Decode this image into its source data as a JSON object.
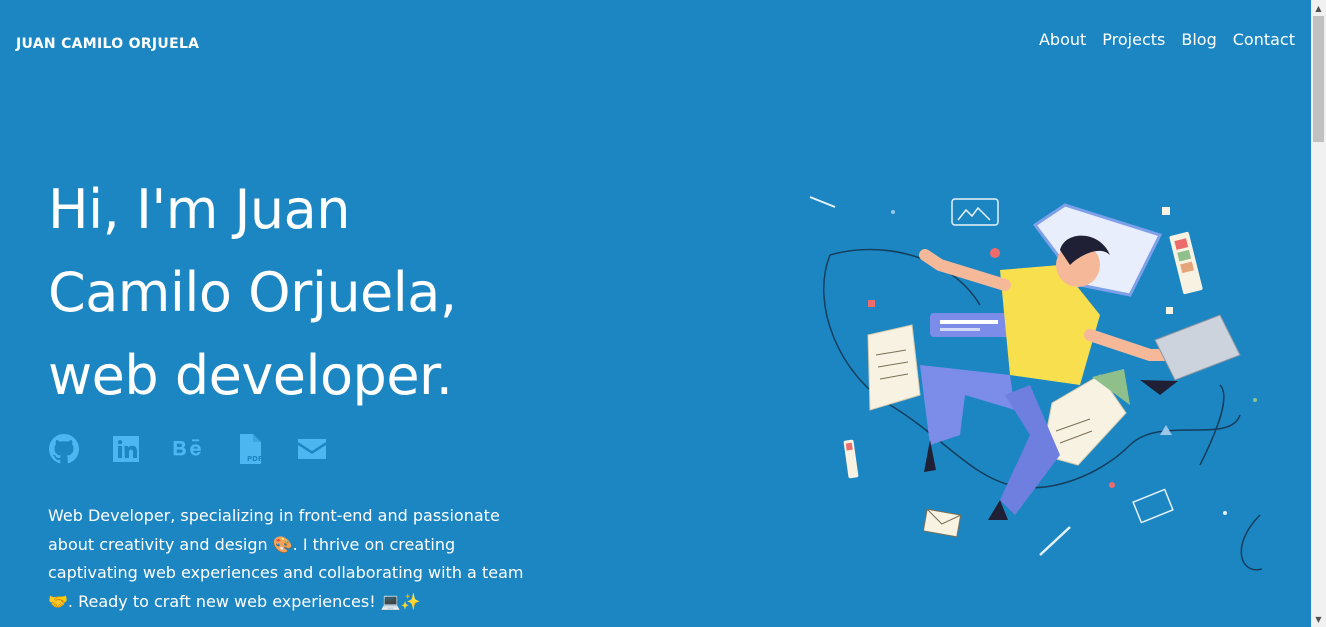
{
  "header": {
    "brand": "JUAN CAMILO ORJUELA",
    "nav": [
      "About",
      "Projects",
      "Blog",
      "Contact"
    ]
  },
  "hero": {
    "title_lines": [
      "Hi, I'm Juan",
      "Camilo Orjuela,",
      "web developer."
    ],
    "bio": "Web Developer, specializing in front-end and passionate about creativity and design 🎨. I thrive on creating captivating web experiences and collaborating with a team 🤝. Ready to craft new web experiences! 💻✨"
  },
  "socials": [
    {
      "icon": "github-icon"
    },
    {
      "icon": "linkedin-icon"
    },
    {
      "icon": "behance-icon"
    },
    {
      "icon": "pdf-file-icon"
    },
    {
      "icon": "envelope-icon"
    }
  ],
  "colors": {
    "background": "#1c86c3",
    "icon_accent": "#4cb6f0",
    "text": "#ffffff"
  }
}
